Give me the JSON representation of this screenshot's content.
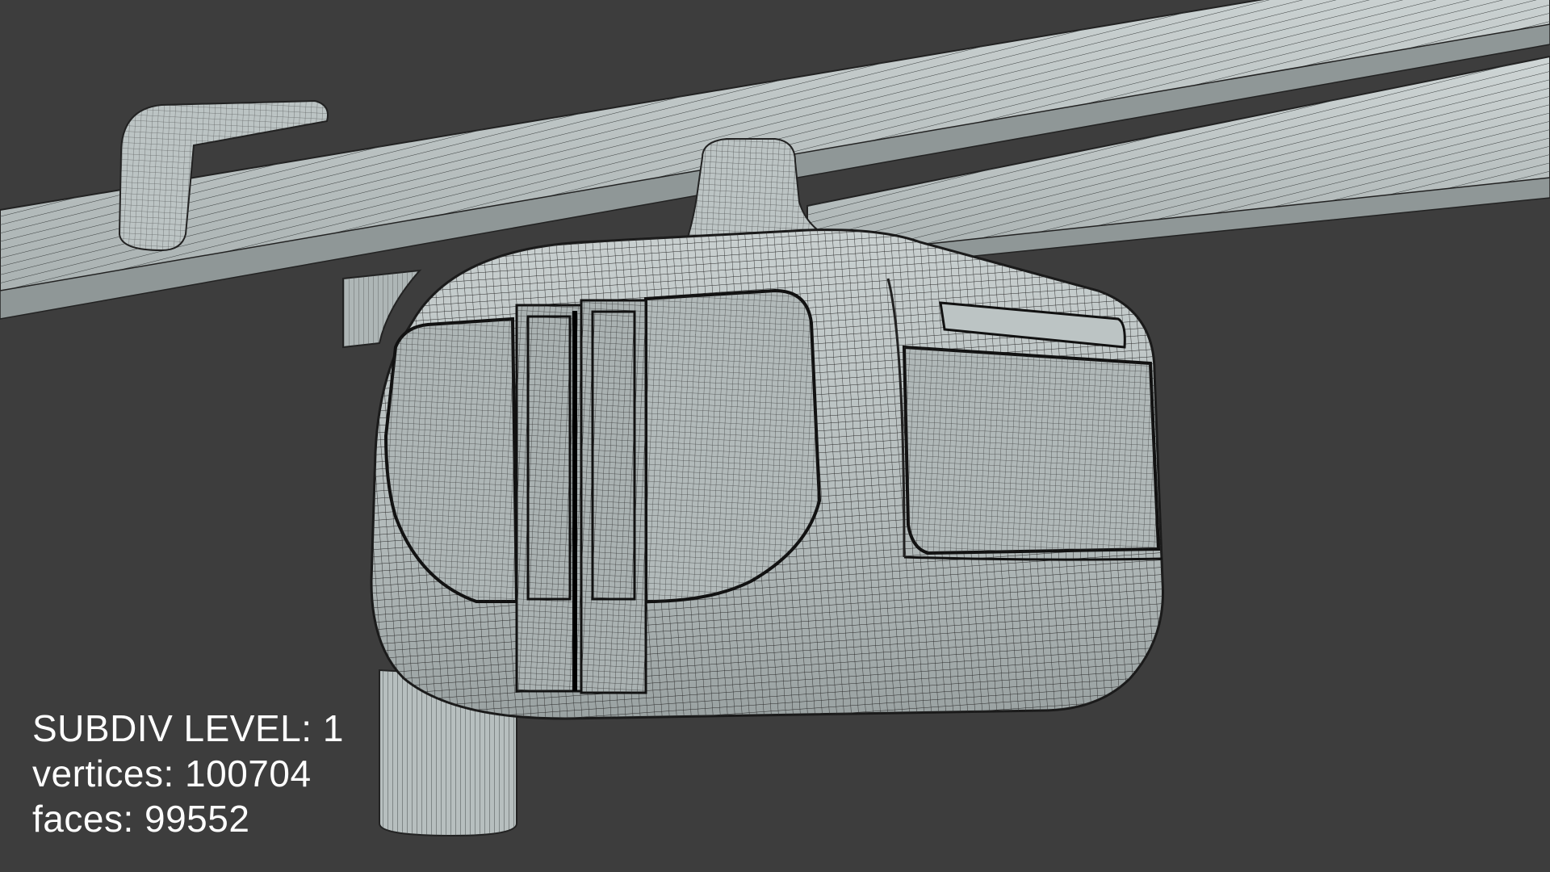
{
  "viewport": {
    "background_color": "#3d3d3d",
    "mesh_color": "#b9c1c1",
    "wire_color": "#2a2a2a"
  },
  "stats": {
    "subdiv_label": "SUBDIV LEVEL: 1",
    "vertices_label": "vertices: 100704",
    "faces_label": "faces: 99552"
  }
}
